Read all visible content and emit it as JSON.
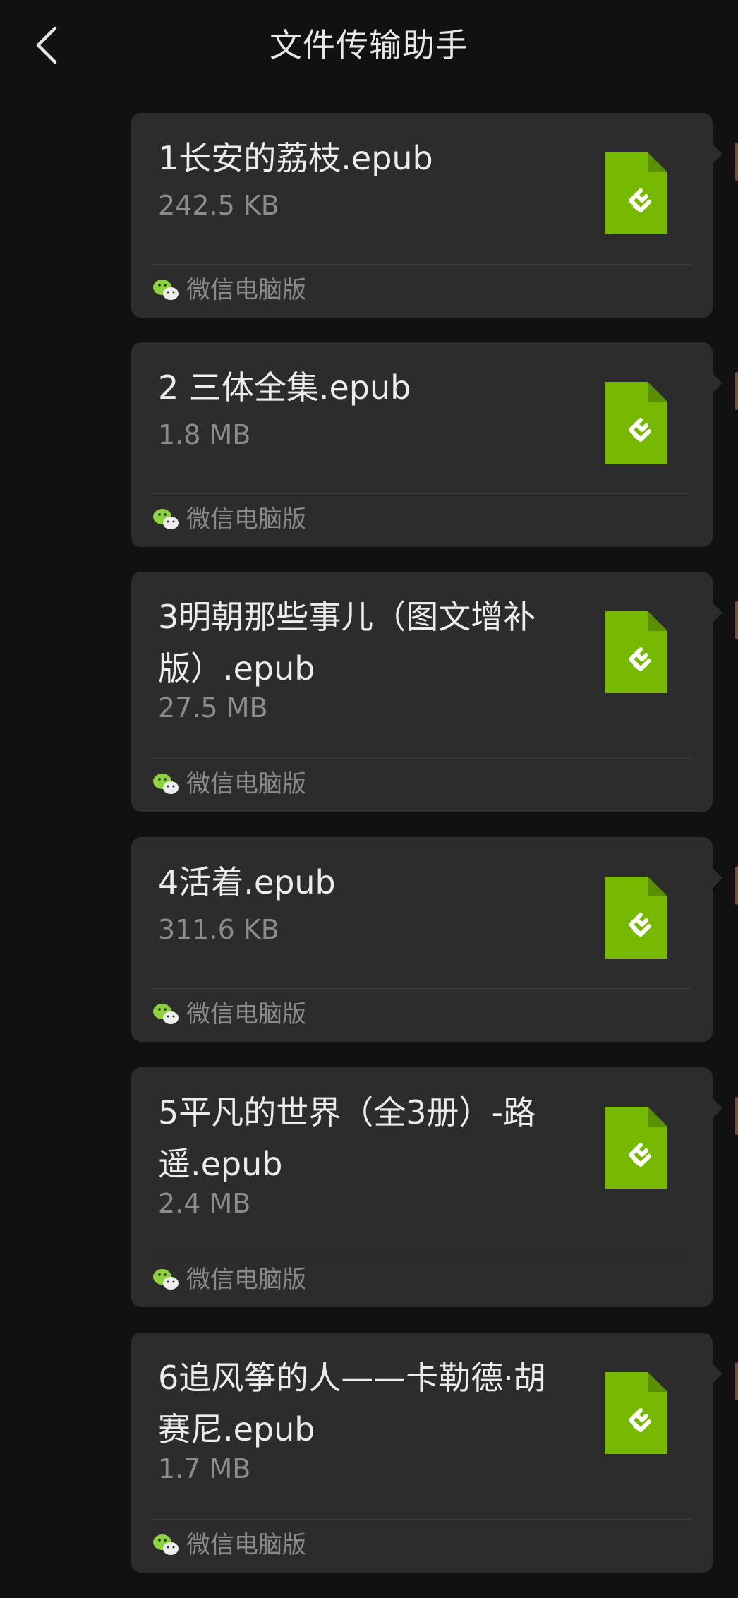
{
  "header": {
    "title": "文件传输助手",
    "back_icon": "chevron-left-icon"
  },
  "messages": [
    {
      "name": "1长安的荔枝.epub",
      "size": "242.5 KB",
      "source": "微信电脑版"
    },
    {
      "name": "2 三体全集.epub",
      "size": "1.8 MB",
      "source": "微信电脑版"
    },
    {
      "name": "3明朝那些事儿（图文增补版）.epub",
      "size": "27.5 MB",
      "source": "微信电脑版"
    },
    {
      "name": "4活着.epub",
      "size": "311.6 KB",
      "source": "微信电脑版"
    },
    {
      "name": "5平凡的世界（全3册）-路遥.epub",
      "size": "2.4 MB",
      "source": "微信电脑版"
    },
    {
      "name": "6追风筝的人——卡勒德·胡赛尼.epub",
      "size": "1.7 MB",
      "source": "微信电脑版"
    }
  ],
  "colors": {
    "background": "#111111",
    "card": "#2c2c2c",
    "file_icon_green": "#76b900",
    "wechat_green": "#8fd13c"
  },
  "icons": {
    "file": "epub-file-icon",
    "source": "wechat-icon"
  }
}
